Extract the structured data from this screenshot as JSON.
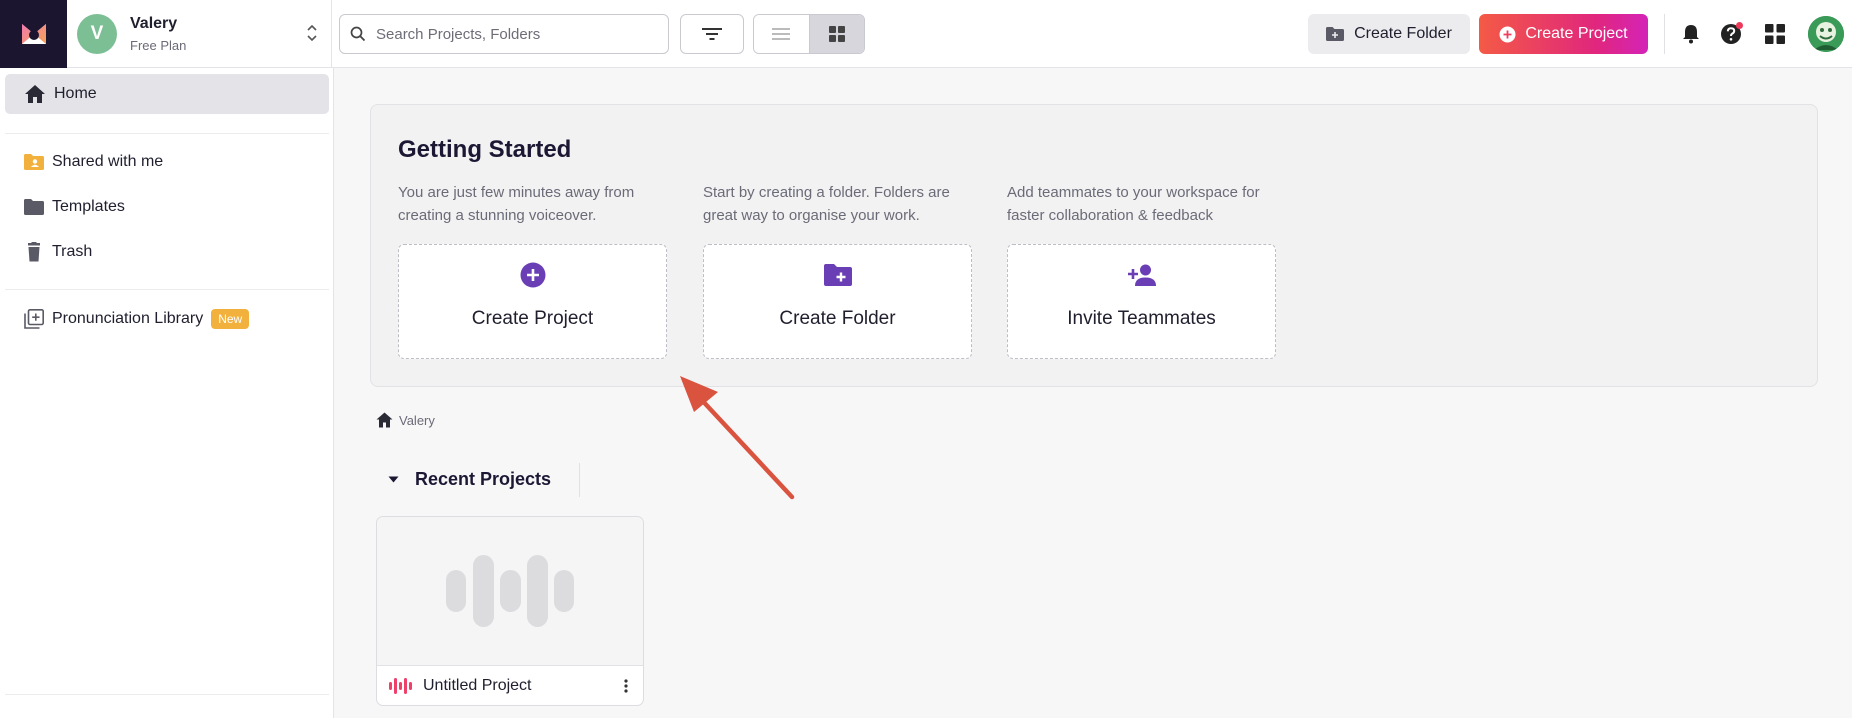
{
  "workspace": {
    "initial": "V",
    "name": "Valery",
    "plan": "Free Plan"
  },
  "search": {
    "placeholder": "Search Projects, Folders"
  },
  "toolbar": {
    "create_folder_label": "Create Folder",
    "create_project_label": "Create Project"
  },
  "sidebar": {
    "items": [
      {
        "label": "Home",
        "icon": "home-icon",
        "active": true
      },
      {
        "label": "Shared with me",
        "icon": "shared-folder-icon"
      },
      {
        "label": "Templates",
        "icon": "folder-icon"
      },
      {
        "label": "Trash",
        "icon": "trash-icon"
      },
      {
        "label": "Pronunciation Library",
        "icon": "library-icon",
        "badge": "New"
      }
    ]
  },
  "getting_started": {
    "title": "Getting Started",
    "cards": [
      {
        "description": "You are just few minutes away from creating a stunning voiceover.",
        "action_label": "Create Project",
        "icon": "plus-circle-icon"
      },
      {
        "description": "Start by creating a folder. Folders are great way to organise your work.",
        "action_label": "Create Folder",
        "icon": "folder-plus-icon"
      },
      {
        "description": "Add teammates to your workspace for faster collaboration & feedback",
        "action_label": "Invite Teammates",
        "icon": "person-add-icon"
      }
    ]
  },
  "breadcrumb": {
    "label": "Valery"
  },
  "recent": {
    "title": "Recent Projects",
    "projects": [
      {
        "name": "Untitled Project"
      }
    ]
  },
  "colors": {
    "accent_purple": "#6a3fb5",
    "brand_gradient_start": "#f45a45",
    "brand_gradient_end": "#d424b8",
    "badge_new": "#f2b13c",
    "annotation_arrow": "#d9533f"
  }
}
